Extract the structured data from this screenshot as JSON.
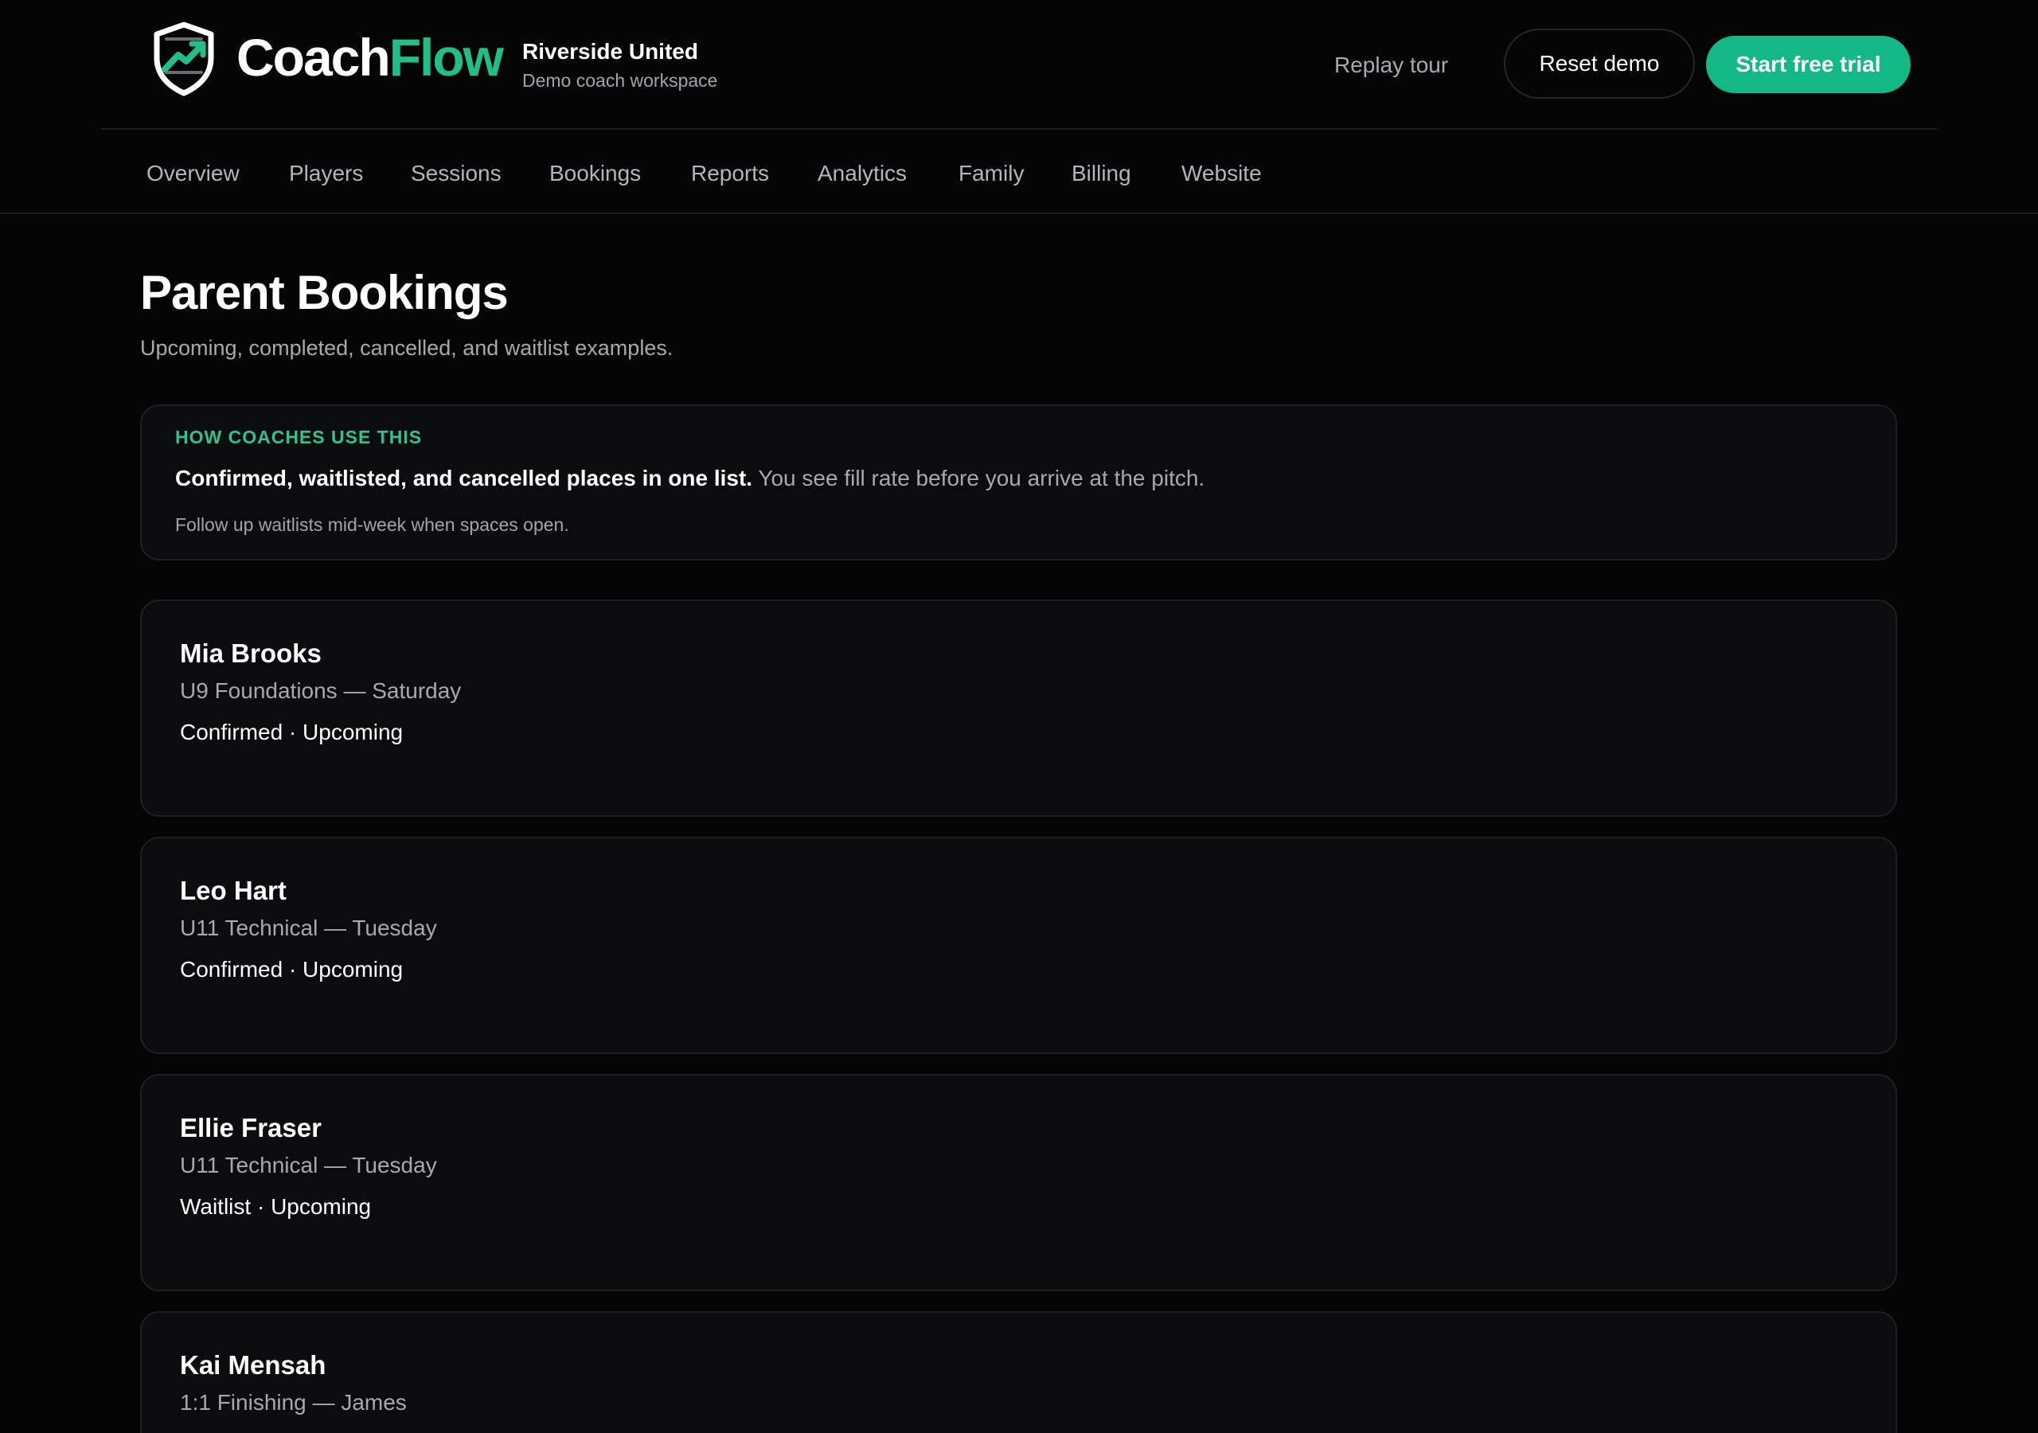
{
  "brand": {
    "name_part1": "Coach",
    "name_part2": "Flow",
    "accent_color": "#1fbf87",
    "logo_icon": "shield-trend-icon"
  },
  "workspace": {
    "org_name": "Riverside United",
    "subtitle": "Demo coach workspace"
  },
  "header_actions": {
    "replay_label": "Replay tour",
    "reset_label": "Reset demo",
    "trial_label": "Start free trial"
  },
  "nav": {
    "items": [
      {
        "label": "Overview"
      },
      {
        "label": "Players"
      },
      {
        "label": "Sessions"
      },
      {
        "label": "Bookings"
      },
      {
        "label": "Reports"
      },
      {
        "label": "Analytics"
      },
      {
        "label": "Family"
      },
      {
        "label": "Billing"
      },
      {
        "label": "Website"
      }
    ]
  },
  "page": {
    "title": "Parent Bookings",
    "subtitle": "Upcoming, completed, cancelled, and waitlist examples."
  },
  "info": {
    "eyebrow": "HOW COACHES USE THIS",
    "headline": "Confirmed, waitlisted, and cancelled places in one list.",
    "body": "You see fill rate before you arrive at the pitch.",
    "note": "Follow up waitlists mid-week when spaces open."
  },
  "bookings": [
    {
      "name": "Mia Brooks",
      "session": "U9 Foundations — Saturday",
      "status": "Confirmed · Upcoming"
    },
    {
      "name": "Leo Hart",
      "session": "U11 Technical — Tuesday",
      "status": "Confirmed · Upcoming"
    },
    {
      "name": "Ellie Fraser",
      "session": "U11 Technical — Tuesday",
      "status": "Waitlist · Upcoming"
    },
    {
      "name": "Kai Mensah",
      "session": "1:1 Finishing — James",
      "status": ""
    }
  ],
  "colors": {
    "background": "#050506",
    "card": "#0b0c0e",
    "primary_button": "#13b886",
    "eyebrow": "#2ec48f"
  }
}
